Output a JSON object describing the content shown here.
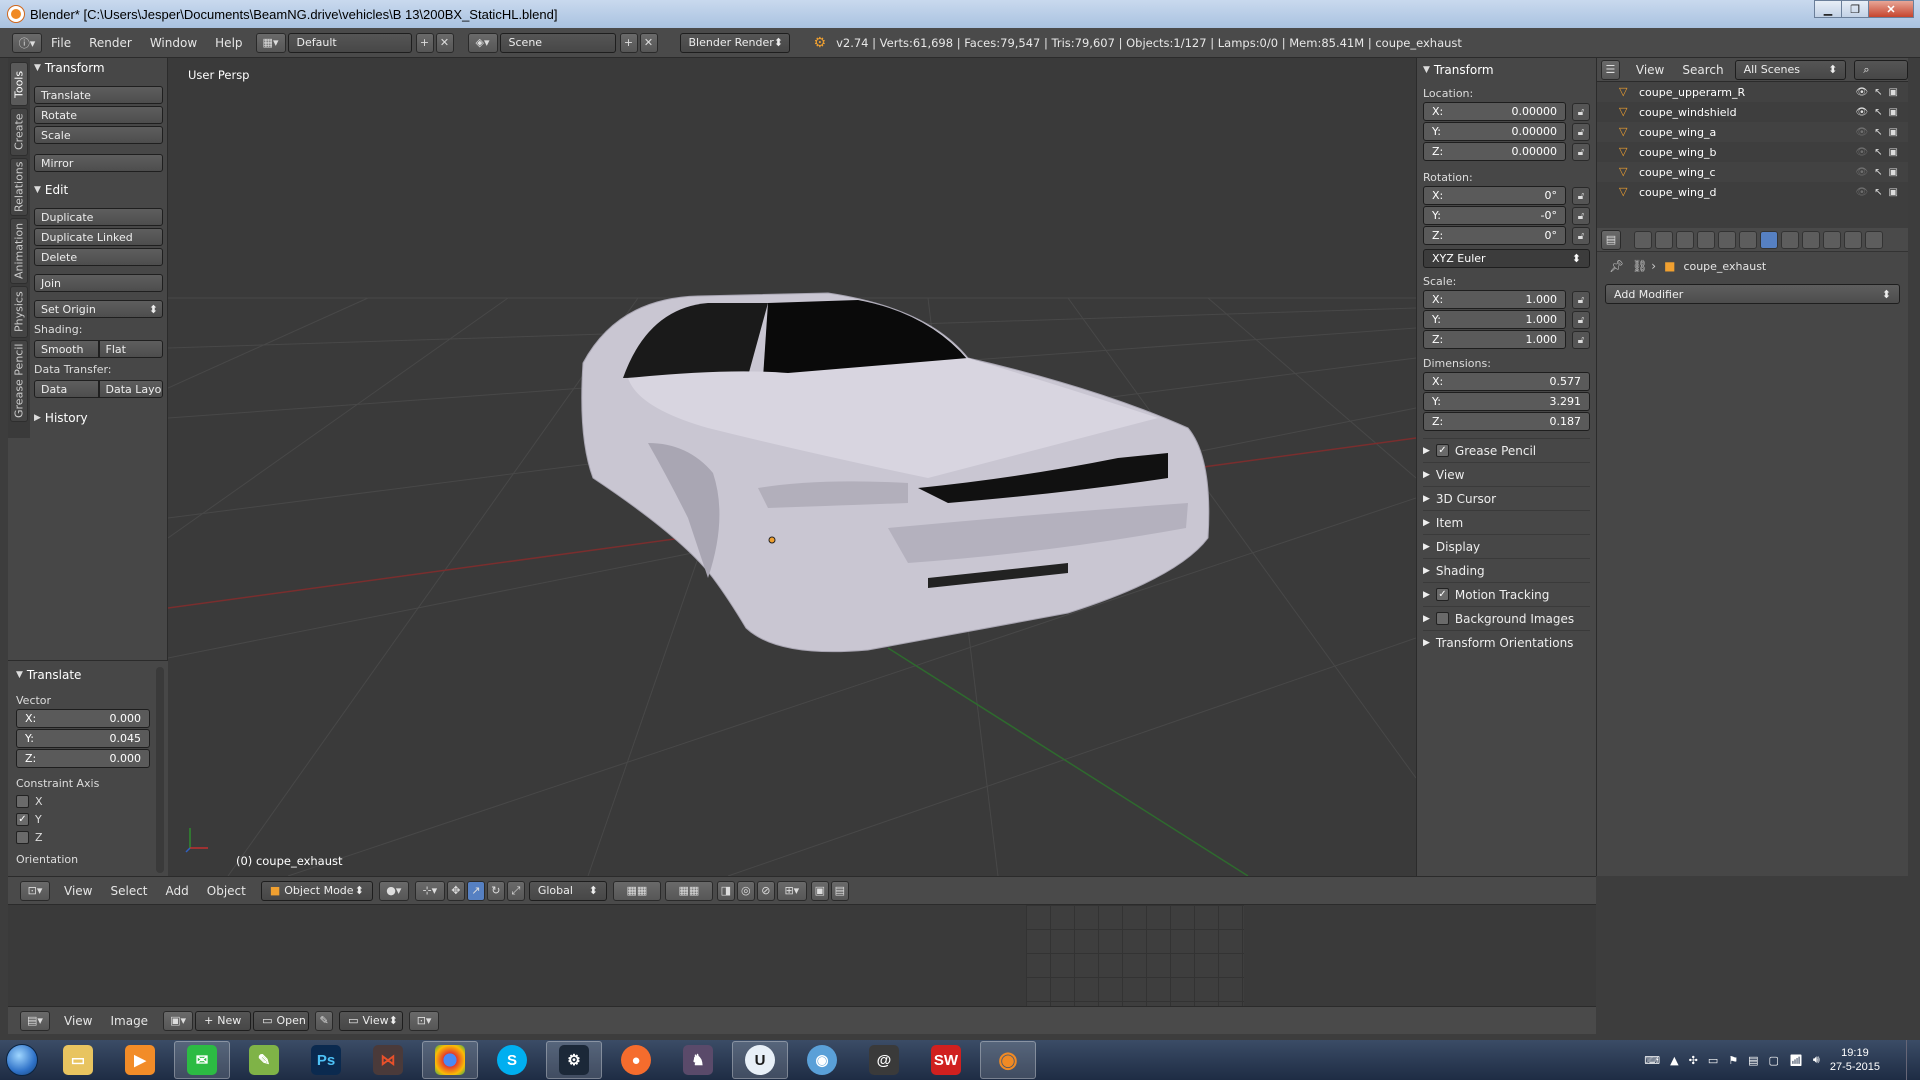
{
  "window": {
    "title": "Blender* [C:\\Users\\Jesper\\Documents\\BeamNG.drive\\vehicles\\B 13\\200BX_StaticHL.blend]"
  },
  "topbar": {
    "menus": [
      "File",
      "Render",
      "Window",
      "Help"
    ],
    "layout": "Default",
    "scene": "Scene",
    "engine": "Blender Render",
    "stats": "v2.74 | Verts:61,698 | Faces:79,547 | Tris:79,607 | Objects:1/127 | Lamps:0/0 | Mem:85.41M | coupe_exhaust"
  },
  "toolshelf": {
    "tabs": [
      "Tools",
      "Create",
      "Relations",
      "Animation",
      "Physics",
      "Grease Pencil"
    ],
    "transform_header": "Transform",
    "translate": "Translate",
    "rotate": "Rotate",
    "scale": "Scale",
    "mirror": "Mirror",
    "edit_header": "Edit",
    "duplicate": "Duplicate",
    "duplicate_linked": "Duplicate Linked",
    "delete": "Delete",
    "join": "Join",
    "set_origin": "Set Origin",
    "shading_label": "Shading:",
    "smooth": "Smooth",
    "flat": "Flat",
    "data_transfer_label": "Data Transfer:",
    "data": "Data",
    "data_layout": "Data Layo",
    "history_header": "History"
  },
  "operator": {
    "header": "Translate",
    "vector_label": "Vector",
    "x": "X:",
    "x_val": "0.000",
    "y": "Y:",
    "y_val": "0.045",
    "z": "Z:",
    "z_val": "0.000",
    "constraint_label": "Constraint Axis",
    "cx": "X",
    "cy": "Y",
    "cz": "Z",
    "orientation_label": "Orientation"
  },
  "viewport": {
    "label": "User Persp",
    "object_label": "(0) coupe_exhaust"
  },
  "properties": {
    "header": "Transform",
    "location_label": "Location:",
    "loc": [
      {
        "axis": "X:",
        "val": "0.00000"
      },
      {
        "axis": "Y:",
        "val": "0.00000"
      },
      {
        "axis": "Z:",
        "val": "0.00000"
      }
    ],
    "rotation_label": "Rotation:",
    "rot": [
      {
        "axis": "X:",
        "val": "0°"
      },
      {
        "axis": "Y:",
        "val": "-0°"
      },
      {
        "axis": "Z:",
        "val": "0°"
      }
    ],
    "rotation_mode": "XYZ Euler",
    "scale_label": "Scale:",
    "scale": [
      {
        "axis": "X:",
        "val": "1.000"
      },
      {
        "axis": "Y:",
        "val": "1.000"
      },
      {
        "axis": "Z:",
        "val": "1.000"
      }
    ],
    "dimensions_label": "Dimensions:",
    "dims": [
      {
        "axis": "X:",
        "val": "0.577"
      },
      {
        "axis": "Y:",
        "val": "3.291"
      },
      {
        "axis": "Z:",
        "val": "0.187"
      }
    ],
    "subpanels": [
      {
        "label": "Grease Pencil",
        "check": true
      },
      {
        "label": "View"
      },
      {
        "label": "3D Cursor"
      },
      {
        "label": "Item"
      },
      {
        "label": "Display"
      },
      {
        "label": "Shading"
      },
      {
        "label": "Motion Tracking",
        "check": true
      },
      {
        "label": "Background Images",
        "check": false
      },
      {
        "label": "Transform Orientations"
      }
    ]
  },
  "outliner": {
    "view": "View",
    "search": "Search",
    "filter": "All Scenes",
    "items": [
      "coupe_upperarm_R",
      "coupe_windshield",
      "coupe_wing_a",
      "coupe_wing_b",
      "coupe_wing_c",
      "coupe_wing_d"
    ]
  },
  "property_editor": {
    "object": "coupe_exhaust",
    "add_modifier": "Add Modifier"
  },
  "header3d": {
    "menus": [
      "View",
      "Select",
      "Add",
      "Object"
    ],
    "mode": "Object Mode",
    "orientation": "Global"
  },
  "image_header": {
    "menus": [
      "View",
      "Image"
    ],
    "new": "New",
    "open": "Open",
    "view": "View"
  },
  "taskbar": {
    "time": "19:19",
    "date": "27-5-2015"
  },
  "colors": {
    "accent": "#5680c2",
    "axis_x": "#8a2e2e",
    "axis_y": "#3a7a2e"
  }
}
